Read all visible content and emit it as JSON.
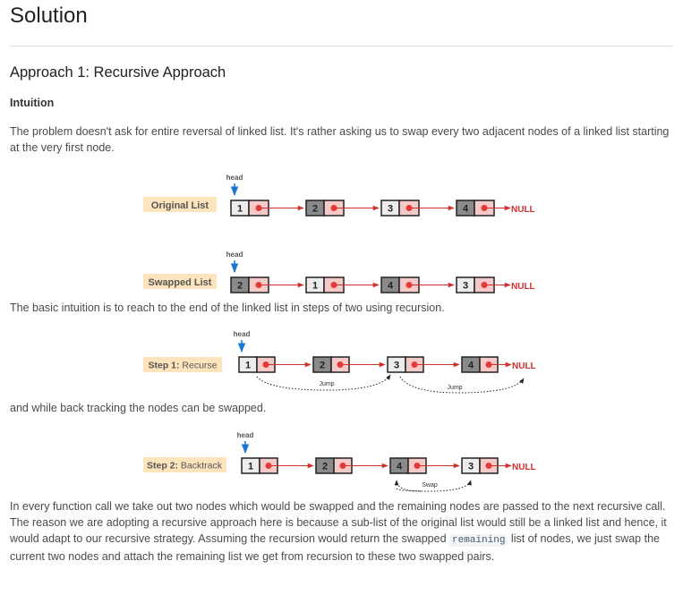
{
  "title": "Solution",
  "approach_title": "Approach 1: Recursive Approach",
  "intuition_heading": "Intuition",
  "para1": "The problem doesn't ask for entire reversal of linked list. It's rather asking us to swap every two adjacent nodes of a linked list starting at the very first node.",
  "para2": "The basic intuition is to reach to the end of the linked list in steps of two using recursion.",
  "para3": "and while back tracking the nodes can be swapped.",
  "para4_before_code": "In every function call we take out two nodes which would be swapped and the remaining nodes are passed to the next recursive call. The reason we are adopting a recursive approach here is because a sub-list of the original list would still be a linked list and hence, it would adapt to our recursive strategy. Assuming the recursion would return the swapped ",
  "para4_code": "remaining",
  "para4_after_code": " list of nodes, we just swap the current two nodes and attach the remaining list we get from recursion to these two swapped pairs.",
  "diagrams": {
    "original": {
      "label": "Original List",
      "head": "head",
      "nodes": [
        "1",
        "2",
        "3",
        "4"
      ],
      "end": "NULL"
    },
    "swapped": {
      "label": "Swapped List",
      "head": "head",
      "nodes": [
        "2",
        "1",
        "4",
        "3"
      ],
      "end": "NULL"
    },
    "step1": {
      "label_bold": "Step 1:",
      "label_rest": " Recurse",
      "head": "head",
      "nodes": [
        "1",
        "2",
        "3",
        "4"
      ],
      "end": "NULL",
      "jump1": "Jump",
      "jump2": "Jump"
    },
    "step2": {
      "label_bold": "Step 2:",
      "label_rest": " Backtrack",
      "head": "head",
      "nodes": [
        "1",
        "2",
        "4",
        "3"
      ],
      "end": "NULL",
      "swap": "Swap"
    }
  },
  "colors": {
    "label_bg": "#fde4bd",
    "dark_node": "#8a8a8a",
    "light_node": "#ececec",
    "pointer_cell": "#f6c9c9",
    "dot": "#e53935",
    "arrow": "#d32f2f",
    "head_arrow": "#1976d2"
  }
}
